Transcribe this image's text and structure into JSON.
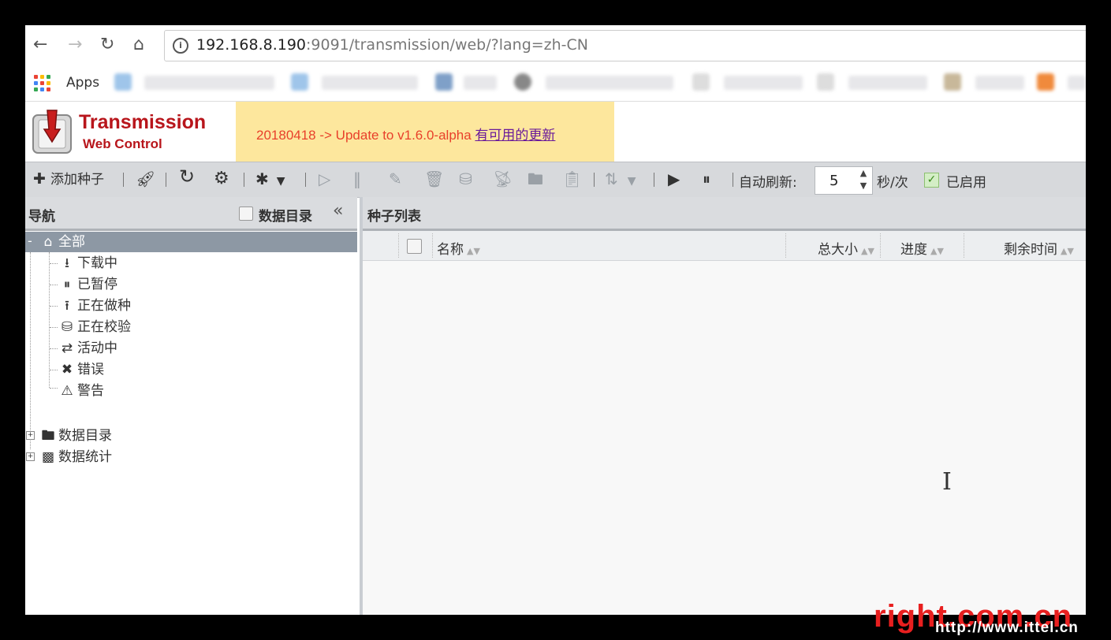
{
  "browser": {
    "url_host": "192.168.8.190",
    "url_rest": ":9091/transmission/web/?lang=zh-CN",
    "apps_label": "Apps"
  },
  "app": {
    "logo_title": "Transmission",
    "logo_subtitle": "Web Control",
    "notice_text": "20180418 -> Update to v1.6.0-alpha",
    "notice_link": "有可用的更新"
  },
  "toolbar": {
    "add_torrent": "添加种子",
    "auto_refresh_label": "自动刷新:",
    "refresh_value": "5",
    "refresh_unit": "秒/次",
    "enabled_label": "已启用"
  },
  "nav": {
    "title": "导航",
    "data_dir_toggle": "数据目录",
    "all": "全部",
    "items": [
      {
        "label": "下载中",
        "icon": "download-icon"
      },
      {
        "label": "已暂停",
        "icon": "pause-circle-icon"
      },
      {
        "label": "正在做种",
        "icon": "upload-icon"
      },
      {
        "label": "正在校验",
        "icon": "verify-icon"
      },
      {
        "label": "活动中",
        "icon": "active-icon"
      },
      {
        "label": "错误",
        "icon": "error-icon"
      },
      {
        "label": "警告",
        "icon": "warning-icon"
      }
    ],
    "data_dirs": "数据目录",
    "data_stats": "数据统计"
  },
  "torrents": {
    "title": "种子列表",
    "columns": [
      "名称",
      "总大小",
      "进度",
      "剩余时间"
    ]
  },
  "watermark": {
    "main": "right.com.cn",
    "url": "http://www.ittel.cn"
  },
  "colors": {
    "logo_red": "#b8151b",
    "notice_bg": "#fde79d",
    "notice_text": "#e8402b",
    "selected_row": "#8d98a4"
  }
}
